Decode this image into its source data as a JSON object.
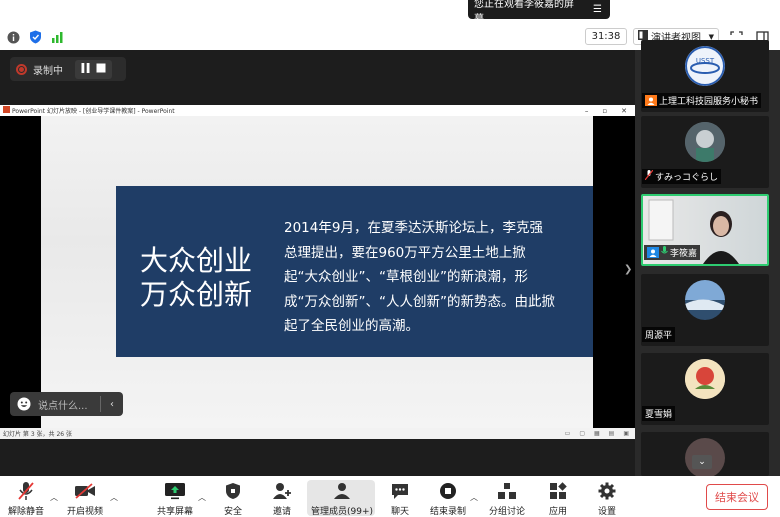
{
  "share_banner": {
    "text": "您正在观看李筱嘉的屏幕",
    "menu_icon": "menu-icon"
  },
  "topbar": {
    "timer": "31:38",
    "view_label": "演讲者视图"
  },
  "recording": {
    "label": "录制中"
  },
  "ppt": {
    "title": "PowerPoint 幻灯片放映 - [创业导学课件教案] - PowerPoint",
    "heading_line1": "大众创业",
    "heading_line2": "万众创新",
    "body": "2014年9月，在夏季达沃斯论坛上，李克强总理提出，要在960万平方公里土地上掀起“大众创业”、“草根创业”的新浪潮，形成“万众创新”、“人人创新”的新势态。由此掀起了全民创业的高潮。",
    "status": "幻灯片 第 3 张，共 26 张"
  },
  "chat": {
    "placeholder": "说点什么..."
  },
  "participants": [
    {
      "name": "上理工科技园服务小秘书",
      "badge": "orange"
    },
    {
      "name": "すみっコぐらし",
      "badge": "none"
    },
    {
      "name": "李筱嘉",
      "badge": "blue"
    },
    {
      "name": "周源平",
      "badge": "none"
    },
    {
      "name": "夏雪娟",
      "badge": "none"
    }
  ],
  "toolbar": {
    "mute": "解除静音",
    "video": "开启视频",
    "share": "共享屏幕",
    "security": "安全",
    "invite": "邀请",
    "members": "管理成员(99+)",
    "chat": "聊天",
    "end_record": "结束录制",
    "breakout": "分组讨论",
    "apps": "应用",
    "settings": "设置",
    "end_meeting": "结束会议"
  },
  "colors": {
    "slide_box": "#1f3d66",
    "active_border": "#2ecc71",
    "end_red": "#e04a4a"
  }
}
